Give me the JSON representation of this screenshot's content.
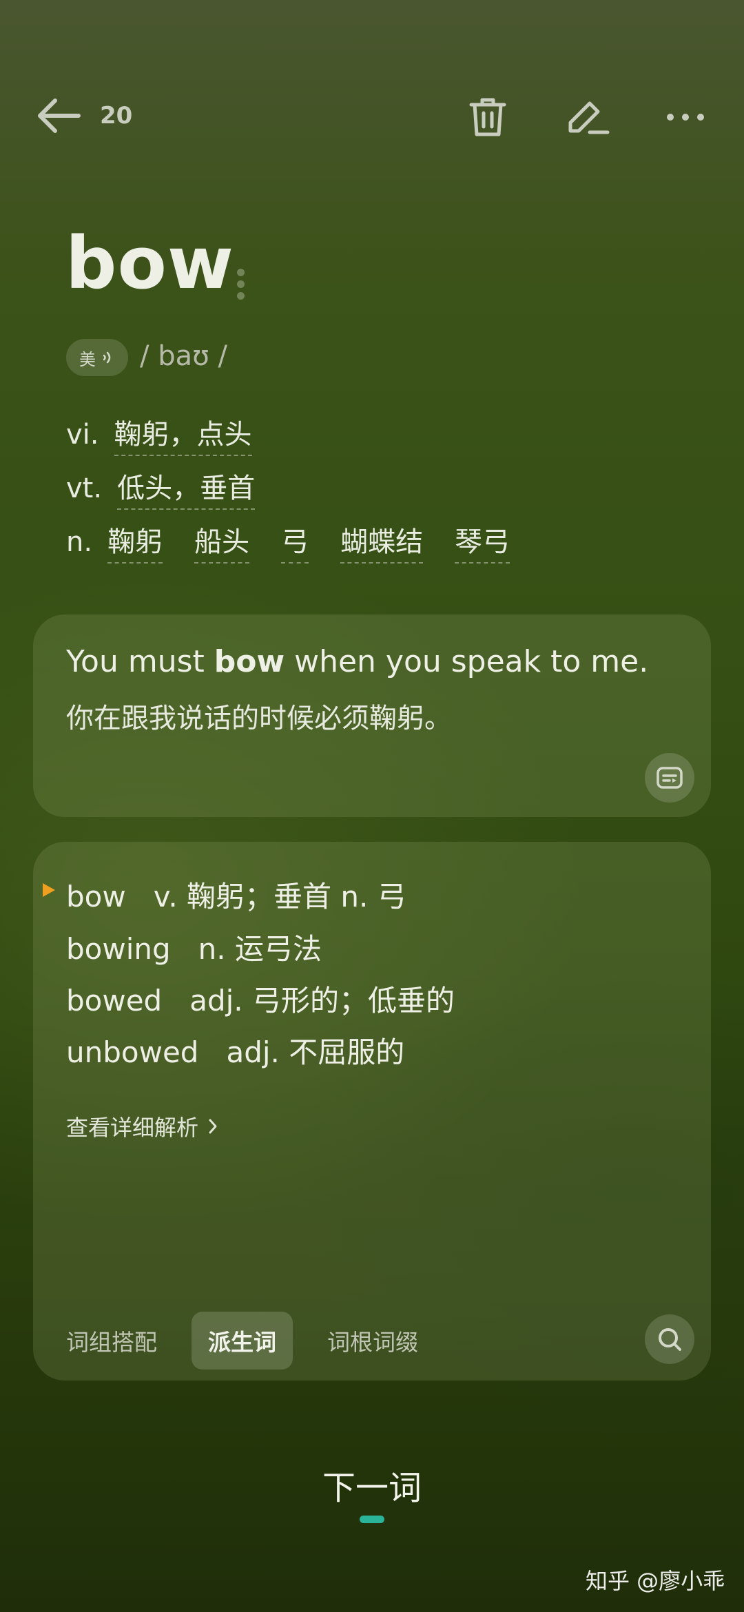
{
  "header": {
    "back_icon": "arrow-left-icon",
    "count": "20",
    "actions": [
      "trash-icon",
      "edit-pencil-icon",
      "more-dots-icon"
    ]
  },
  "word": {
    "headword": "bow",
    "accent_label": "美",
    "phonetic": "/ baʊ /",
    "definitions": [
      {
        "pos": "vi.",
        "meanings": [
          "鞠躬，点头"
        ]
      },
      {
        "pos": "vt.",
        "meanings": [
          "低头，垂首"
        ]
      },
      {
        "pos": "n.",
        "meanings": [
          "鞠躬",
          "船头",
          "弓",
          "蝴蝶结",
          "琴弓"
        ]
      }
    ]
  },
  "example": {
    "en_before": "You must ",
    "en_bold": "bow",
    "en_after": " when you speak to me.",
    "zh": "你在跟我说话的时候必须鞠躬。",
    "video_icon": "video-subtitle-icon"
  },
  "derivatives": {
    "items": [
      {
        "word": "bow",
        "meaning": "v. 鞠躬；垂首 n. 弓"
      },
      {
        "word": "bowing",
        "meaning": "n. 运弓法"
      },
      {
        "word": "bowed",
        "meaning": "adj. 弓形的；低垂的"
      },
      {
        "word": "unbowed",
        "meaning": "adj. 不屈服的"
      }
    ],
    "more_label": "查看详细解析",
    "tabs": [
      "词组搭配",
      "派生词",
      "词根词缀"
    ],
    "active_tab": "派生词",
    "search_icon": "search-icon",
    "accent_color": "#f0a020"
  },
  "footer": {
    "next_label": "下一词",
    "indicator_color": "#2bb39a",
    "watermark": "知乎 @廖小乖"
  }
}
